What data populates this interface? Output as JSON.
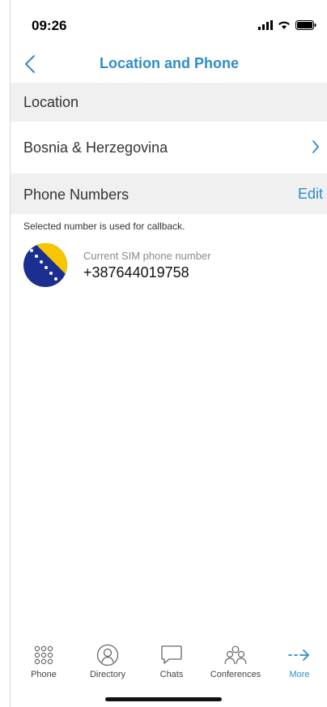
{
  "status_bar": {
    "time": "09:26"
  },
  "nav": {
    "title": "Location and Phone"
  },
  "location": {
    "header": "Location",
    "country": "Bosnia & Herzegovina"
  },
  "phone_numbers": {
    "header": "Phone Numbers",
    "edit_label": "Edit",
    "hint": "Selected number is used for callback.",
    "entries": [
      {
        "caption": "Current SIM phone number",
        "number": "+387644019758",
        "flag": "Bosnia & Herzegovina"
      }
    ]
  },
  "tabs": [
    {
      "label": "Phone",
      "icon": "dialpad-icon",
      "active": false
    },
    {
      "label": "Directory",
      "icon": "directory-icon",
      "active": false
    },
    {
      "label": "Chats",
      "icon": "chat-bubble-icon",
      "active": false
    },
    {
      "label": "Conferences",
      "icon": "conferences-icon",
      "active": false
    },
    {
      "label": "More",
      "icon": "more-arrow-icon",
      "active": true
    }
  ],
  "colors": {
    "accent": "#2d8dc9",
    "section_bg": "#f0f0f0"
  }
}
